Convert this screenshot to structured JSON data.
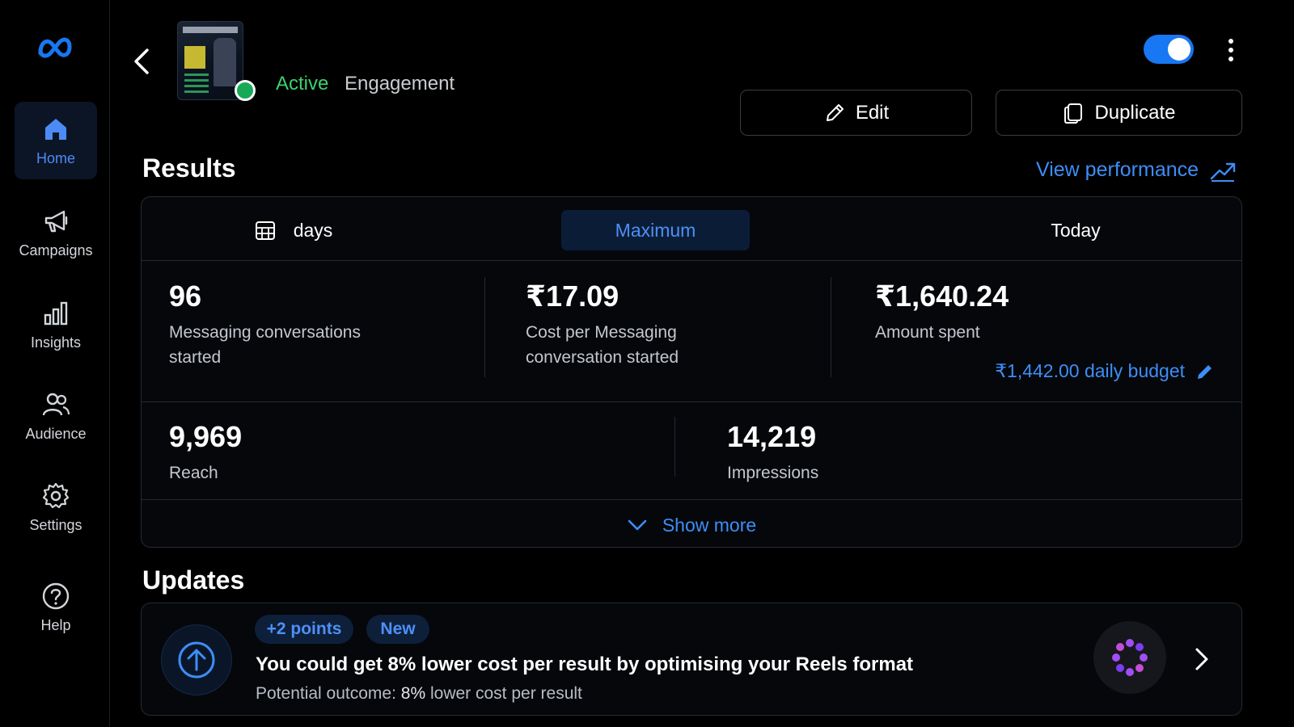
{
  "sidebar": {
    "logo": "meta-logo",
    "items": [
      {
        "label": "Home",
        "icon": "home-icon",
        "active": true
      },
      {
        "label": "Campaigns",
        "icon": "megaphone-icon"
      },
      {
        "label": "Insights",
        "icon": "bar-chart-icon"
      },
      {
        "label": "Audience",
        "icon": "people-icon"
      },
      {
        "label": "Settings",
        "icon": "gear-icon"
      },
      {
        "label": "Help",
        "icon": "help-icon"
      }
    ]
  },
  "header": {
    "status": "Active",
    "objective": "Engagement",
    "toggle_on": true,
    "edit_label": "Edit",
    "duplicate_label": "Duplicate"
  },
  "results": {
    "title": "Results",
    "view_performance": "View performance",
    "tabs": {
      "days": "days",
      "maximum": "Maximum",
      "today": "Today",
      "selected": "Maximum"
    },
    "metrics": [
      {
        "value": "96",
        "label": "Messaging conversations started"
      },
      {
        "value": "₹17.09",
        "label": "Cost per Messaging conversation started"
      },
      {
        "value": "₹1,640.24",
        "label": "Amount spent"
      },
      {
        "value": "9,969",
        "label": "Reach"
      },
      {
        "value": "14,219",
        "label": "Impressions"
      }
    ],
    "daily_budget": "₹1,442.00 daily budget",
    "show_more": "Show more"
  },
  "updates": {
    "title": "Updates",
    "card": {
      "badge_points": "+2 points",
      "badge_new": "New",
      "headline": "You could get 8% lower cost per result by optimising your Reels format",
      "sub_prefix": "Potential outcome:",
      "sub_highlight": "8%",
      "sub_suffix": "lower cost per result"
    }
  },
  "colors": {
    "accent_blue": "#3d8ef7",
    "active_green": "#3bd16f",
    "toggle_blue": "#1877f2",
    "background": "#000000"
  }
}
